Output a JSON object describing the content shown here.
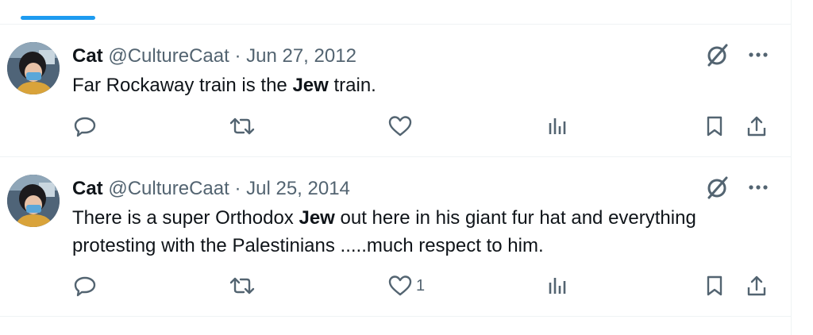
{
  "tweets": [
    {
      "author_name": "Cat",
      "handle": "@CultureCaat",
      "separator": "·",
      "date": "Jun 27, 2012",
      "text_before": "Far Rockaway train is the ",
      "text_bold": "Jew",
      "text_after": " train.",
      "like_count": ""
    },
    {
      "author_name": "Cat",
      "handle": "@CultureCaat",
      "separator": "·",
      "date": "Jul 25, 2014",
      "text_before": "There is a super Orthodox ",
      "text_bold": "Jew",
      "text_after": " out here in his giant fur hat and everything protesting with the Palestinians .....much respect to him.",
      "like_count": "1"
    }
  ],
  "icons": {
    "reply": "reply-icon",
    "retweet": "retweet-icon",
    "like": "like-icon",
    "views": "views-icon",
    "bookmark": "bookmark-icon",
    "share": "share-icon",
    "grok": "grok-icon",
    "more": "more-icon"
  },
  "colors": {
    "accent": "#1d9bf0",
    "text": "#0f1419",
    "muted": "#536471",
    "divider": "#eff3f4"
  }
}
